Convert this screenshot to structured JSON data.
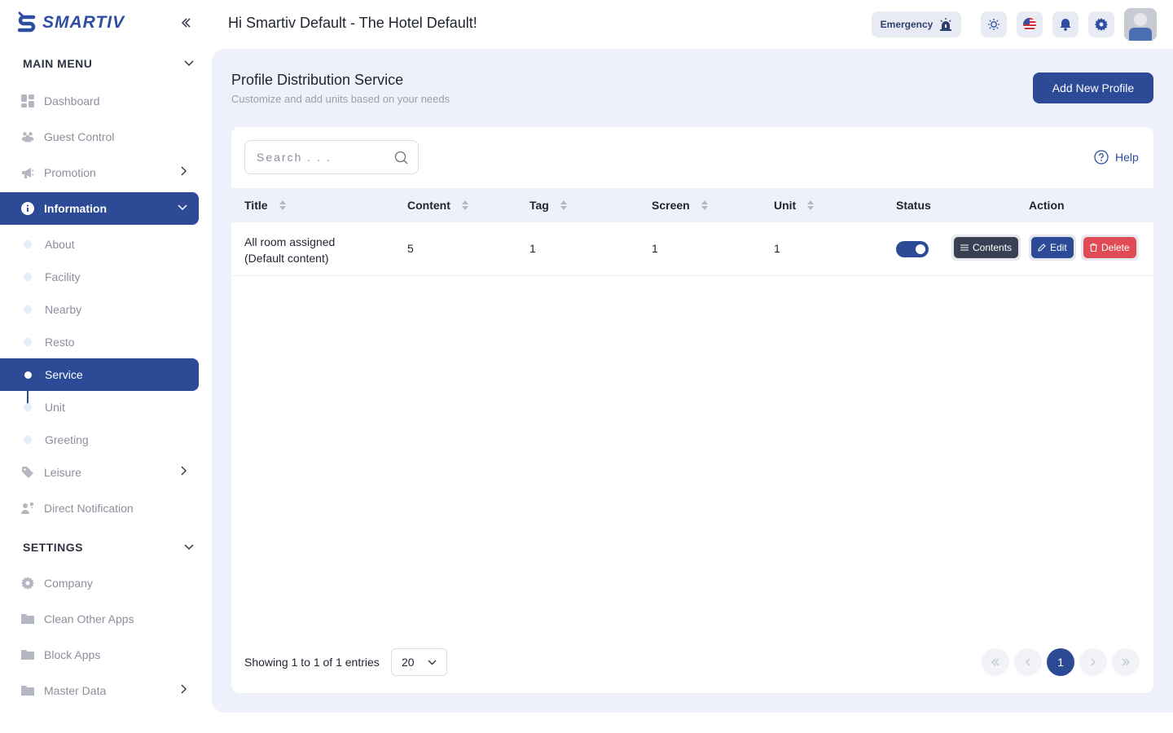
{
  "app": {
    "logo_text": "SMARTIV",
    "greeting": "Hi Smartiv Default - The Hotel Default!"
  },
  "topbar": {
    "emergency_label": "Emergency"
  },
  "sidebar": {
    "main_menu_label": "MAIN MENU",
    "settings_label": "SETTINGS",
    "items": {
      "dashboard": "Dashboard",
      "guest_control": "Guest Control",
      "promotion": "Promotion",
      "information": "Information",
      "leisure": "Leisure",
      "direct_notification": "Direct Notification",
      "company": "Company",
      "clean_other_apps": "Clean Other Apps",
      "block_apps": "Block Apps",
      "master_data": "Master Data"
    },
    "information_sub": {
      "about": "About",
      "facility": "Facility",
      "nearby": "Nearby",
      "resto": "Resto",
      "service": "Service",
      "unit": "Unit",
      "greeting": "Greeting"
    }
  },
  "page": {
    "title": "Profile Distribution Service",
    "subtitle": "Customize and add units based on your needs",
    "add_button": "Add New Profile",
    "search_placeholder": "Search . . .",
    "help_label": "Help"
  },
  "table": {
    "columns": {
      "title": "Title",
      "content": "Content",
      "tag": "Tag",
      "screen": "Screen",
      "unit": "Unit",
      "status": "Status",
      "action": "Action"
    },
    "rows": [
      {
        "title_line1": "All room assigned",
        "title_line2": "(Default content)",
        "content": "5",
        "tag": "1",
        "screen": "1",
        "unit": "1",
        "status_on": true
      }
    ],
    "actions": {
      "contents": "Contents",
      "edit": "Edit",
      "delete": "Delete"
    }
  },
  "pagination": {
    "showing": "Showing 1 to 1 of 1 entries",
    "per_page": "20",
    "current_page": "1"
  },
  "colors": {
    "primary": "#2d4a97",
    "contents_btn": "#3a4054",
    "delete_btn": "#e04b55",
    "main_bg": "#eef1fb"
  }
}
